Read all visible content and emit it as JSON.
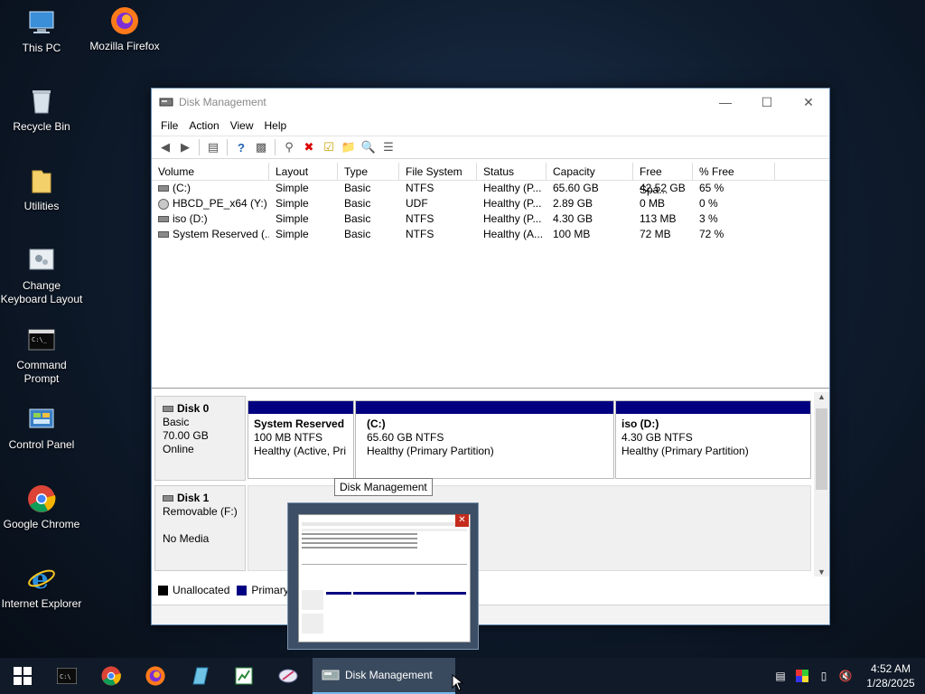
{
  "desktop": {
    "icons": [
      {
        "label": "This PC"
      },
      {
        "label": "Mozilla Firefox"
      },
      {
        "label": "Recycle Bin"
      },
      {
        "label": "Utilities"
      },
      {
        "label": "Change Keyboard Layout"
      },
      {
        "label": "Command Prompt"
      },
      {
        "label": "Control Panel"
      },
      {
        "label": "Google Chrome"
      },
      {
        "label": "Internet Explorer"
      }
    ]
  },
  "window": {
    "title": "Disk Management",
    "menu": [
      "File",
      "Action",
      "View",
      "Help"
    ]
  },
  "volumes": {
    "headers": [
      "Volume",
      "Layout",
      "Type",
      "File System",
      "Status",
      "Capacity",
      "Free Spa...",
      "% Free"
    ],
    "rows": [
      {
        "volume": "(C:)",
        "layout": "Simple",
        "type": "Basic",
        "fs": "NTFS",
        "status": "Healthy (P...",
        "capacity": "65.60 GB",
        "free": "42.52 GB",
        "pct": "65 %"
      },
      {
        "volume": "HBCD_PE_x64 (Y:)",
        "layout": "Simple",
        "type": "Basic",
        "fs": "UDF",
        "status": "Healthy (P...",
        "capacity": "2.89 GB",
        "free": "0 MB",
        "pct": "0 %"
      },
      {
        "volume": "iso (D:)",
        "layout": "Simple",
        "type": "Basic",
        "fs": "NTFS",
        "status": "Healthy (P...",
        "capacity": "4.30 GB",
        "free": "113 MB",
        "pct": "3 %"
      },
      {
        "volume": "System Reserved (...",
        "layout": "Simple",
        "type": "Basic",
        "fs": "NTFS",
        "status": "Healthy (A...",
        "capacity": "100 MB",
        "free": "72 MB",
        "pct": "72 %"
      }
    ]
  },
  "disks": [
    {
      "name": "Disk 0",
      "type": "Basic",
      "size": "70.00 GB",
      "state": "Online",
      "partitions": [
        {
          "name": "System Reserved",
          "size": "100 MB NTFS",
          "status": "Healthy (Active, Pri"
        },
        {
          "name": "(C:)",
          "size": "65.60 GB NTFS",
          "status": "Healthy (Primary Partition)"
        },
        {
          "name": "iso  (D:)",
          "size": "4.30 GB NTFS",
          "status": "Healthy (Primary Partition)"
        }
      ]
    },
    {
      "name": "Disk 1",
      "type": "Removable (F:)",
      "state": "No Media"
    }
  ],
  "legend": [
    "Unallocated",
    "Primary"
  ],
  "tooltip": "Disk Management",
  "taskbar": {
    "active_label": "Disk Management",
    "time": "4:52 AM",
    "date": "1/28/2025"
  },
  "colors": {
    "primary_partition": "#000080",
    "unallocated": "#000000",
    "accent": "#76b9ed"
  }
}
